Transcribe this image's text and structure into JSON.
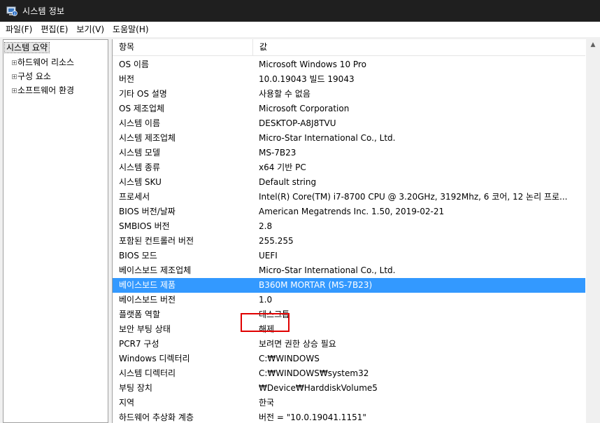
{
  "window": {
    "title": "시스템 정보"
  },
  "menu": [
    "파일(F)",
    "편집(E)",
    "보기(V)",
    "도움말(H)"
  ],
  "tree": {
    "root": "시스템 요약",
    "children": [
      "하드웨어 리소스",
      "구성 요소",
      "소프트웨어 환경"
    ]
  },
  "table": {
    "headers": [
      "항목",
      "값"
    ],
    "selected_index": 15,
    "rows": [
      {
        "item": "OS 이름",
        "value": "Microsoft Windows 10 Pro"
      },
      {
        "item": "버전",
        "value": "10.0.19043 빌드 19043"
      },
      {
        "item": "기타 OS 설명",
        "value": "사용할 수 없음"
      },
      {
        "item": "OS 제조업체",
        "value": "Microsoft Corporation"
      },
      {
        "item": "시스템 이름",
        "value": "DESKTOP-A8J8TVU"
      },
      {
        "item": "시스템 제조업체",
        "value": "Micro-Star International Co., Ltd."
      },
      {
        "item": "시스템 모델",
        "value": "MS-7B23"
      },
      {
        "item": "시스템 종류",
        "value": "x64 기반 PC"
      },
      {
        "item": "시스템 SKU",
        "value": "Default string"
      },
      {
        "item": "프로세서",
        "value": "Intel(R) Core(TM) i7-8700 CPU @ 3.20GHz, 3192Mhz, 6 코어, 12 논리 프로..."
      },
      {
        "item": "BIOS 버전/날짜",
        "value": "American Megatrends Inc. 1.50, 2019-02-21"
      },
      {
        "item": "SMBIOS 버전",
        "value": "2.8"
      },
      {
        "item": "포함된 컨트롤러 버전",
        "value": "255.255"
      },
      {
        "item": "BIOS 모드",
        "value": "UEFI"
      },
      {
        "item": "베이스보드 제조업체",
        "value": "Micro-Star International Co., Ltd."
      },
      {
        "item": "베이스보드 제품",
        "value": "B360M MORTAR (MS-7B23)"
      },
      {
        "item": "베이스보드 버전",
        "value": "1.0"
      },
      {
        "item": "플랫폼 역할",
        "value": "데스크톱"
      },
      {
        "item": "보안 부팅 상태",
        "value": "해제"
      },
      {
        "item": "PCR7 구성",
        "value": "보려면 권한 상승 필요"
      },
      {
        "item": "Windows 디렉터리",
        "value": "C:₩WINDOWS"
      },
      {
        "item": "시스템 디렉터리",
        "value": "C:₩WINDOWS₩system32"
      },
      {
        "item": "부팅 장치",
        "value": "₩Device₩HarddiskVolume5"
      },
      {
        "item": "지역",
        "value": "한국"
      },
      {
        "item": "하드웨어 추상화 계층",
        "value": "버전 = \"10.0.19041.1151\""
      }
    ]
  },
  "icons": {
    "app": "system-info-icon",
    "expand": "plus-expander-icon",
    "scroll_up": "scroll-up-arrow-icon",
    "scroll_down": "scroll-down-arrow-icon"
  },
  "colors": {
    "selection": "#3399ff",
    "titlebar": "#1f1f1f",
    "annotation": "#e00000"
  }
}
